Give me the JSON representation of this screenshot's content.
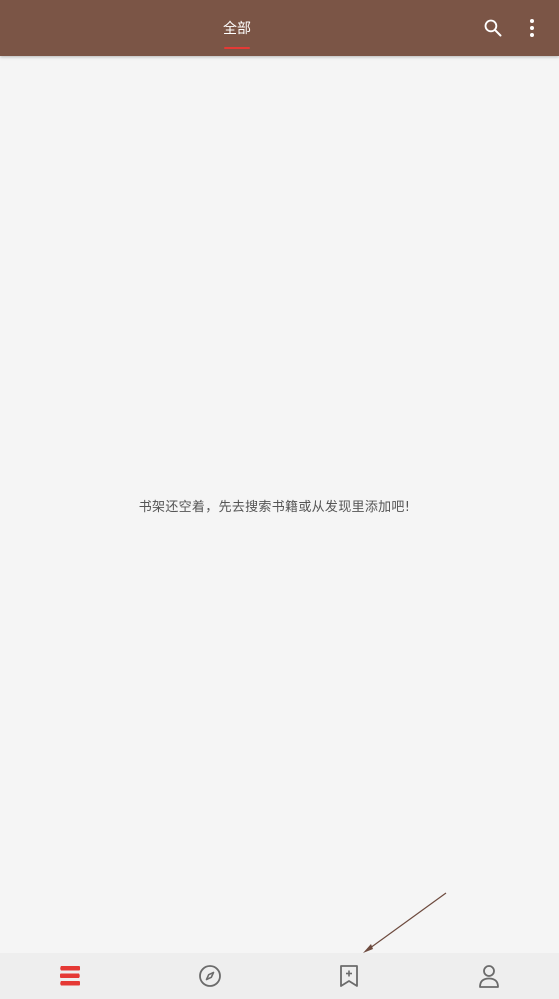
{
  "header": {
    "tabs": [
      {
        "label": "全部",
        "selected": true
      }
    ],
    "actions": [
      {
        "icon": "search-icon"
      },
      {
        "icon": "more-vert-icon"
      }
    ],
    "colors": {
      "bar": "#7b5546",
      "indicator": "#e53935"
    }
  },
  "main": {
    "empty_message": "书架还空着，先去搜索书籍或从发现里添加吧!"
  },
  "bottom_nav": {
    "items": [
      {
        "icon": "bookshelf-icon",
        "active": true
      },
      {
        "icon": "compass-icon",
        "active": false
      },
      {
        "icon": "bookmark-add-icon",
        "active": false
      },
      {
        "icon": "person-icon",
        "active": false
      }
    ],
    "colors": {
      "active": "#e53935",
      "inactive": "#6b6b6b",
      "background": "#eeeeee"
    }
  }
}
